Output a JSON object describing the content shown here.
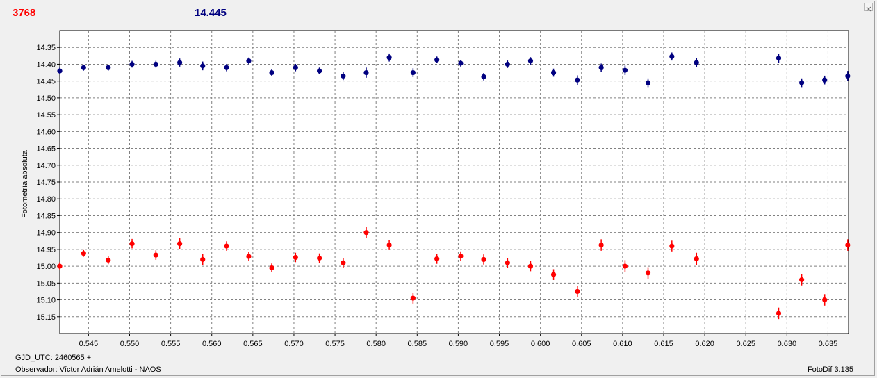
{
  "header": {
    "left_value": "3768",
    "right_value": "14.445"
  },
  "footer": {
    "gjd": "GJD_UTC: 2460565 +",
    "observer": "Observador: Víctor Adrián Amelotti - NAOS",
    "version": "FotoDif 3.135"
  },
  "colors": {
    "series_red": "#ff0000",
    "series_blue": "#000080"
  },
  "icons": {
    "close": "close-icon"
  },
  "chart_data": {
    "type": "scatter",
    "ylabel": "Fotometría absoluta",
    "xlabel": "",
    "xlim": [
      0.5415,
      0.6375
    ],
    "ylim": [
      14.3,
      15.2
    ],
    "y_inverted": true,
    "grid": true,
    "x_ticks": [
      "0.545",
      "0.550",
      "0.555",
      "0.560",
      "0.565",
      "0.570",
      "0.575",
      "0.580",
      "0.585",
      "0.590",
      "0.595",
      "0.600",
      "0.605",
      "0.610",
      "0.615",
      "0.620",
      "0.625",
      "0.630",
      "0.635"
    ],
    "y_ticks": [
      "14.35",
      "14.40",
      "14.45",
      "14.50",
      "14.55",
      "14.60",
      "14.65",
      "14.70",
      "14.75",
      "14.80",
      "14.85",
      "14.90",
      "14.95",
      "15.00",
      "15.05",
      "15.10",
      "15.15"
    ],
    "series": [
      {
        "color": "#000080",
        "x": [
          0.5415,
          0.5444,
          0.5474,
          0.5503,
          0.5532,
          0.5561,
          0.5589,
          0.5618,
          0.5645,
          0.5673,
          0.5702,
          0.5731,
          0.576,
          0.5788,
          0.5816,
          0.5845,
          0.5874,
          0.5903,
          0.5931,
          0.596,
          0.5988,
          0.6016,
          0.6045,
          0.6074,
          0.6103,
          0.6131,
          0.616,
          0.619,
          0.629,
          0.6318,
          0.6346,
          0.6374
        ],
        "y": [
          14.42,
          14.41,
          14.41,
          14.4,
          14.4,
          14.395,
          14.405,
          14.41,
          14.39,
          14.425,
          14.41,
          14.42,
          14.435,
          14.425,
          14.38,
          14.425,
          14.387,
          14.397,
          14.437,
          14.4,
          14.39,
          14.425,
          14.447,
          14.41,
          14.418,
          14.455,
          14.377,
          14.395,
          14.382,
          14.455,
          14.447,
          14.435
        ],
        "err": [
          0.01,
          0.009,
          0.009,
          0.01,
          0.01,
          0.012,
          0.013,
          0.011,
          0.01,
          0.01,
          0.011,
          0.01,
          0.012,
          0.015,
          0.012,
          0.013,
          0.01,
          0.01,
          0.011,
          0.011,
          0.011,
          0.012,
          0.014,
          0.012,
          0.014,
          0.013,
          0.012,
          0.013,
          0.013,
          0.013,
          0.013,
          0.015
        ]
      },
      {
        "color": "#ff0000",
        "x": [
          0.5415,
          0.5444,
          0.5474,
          0.5503,
          0.5532,
          0.5561,
          0.5589,
          0.5618,
          0.5645,
          0.5673,
          0.5702,
          0.5731,
          0.576,
          0.5788,
          0.5816,
          0.5845,
          0.5874,
          0.5903,
          0.5931,
          0.596,
          0.5988,
          0.6016,
          0.6045,
          0.6074,
          0.6103,
          0.6131,
          0.616,
          0.619,
          0.629,
          0.6318,
          0.6346,
          0.6374
        ],
        "y": [
          15.0,
          14.962,
          14.982,
          14.933,
          14.967,
          14.933,
          14.98,
          14.94,
          14.971,
          15.005,
          14.974,
          14.976,
          14.99,
          14.9,
          14.937,
          15.095,
          14.978,
          14.97,
          14.98,
          14.99,
          15.0,
          15.025,
          15.075,
          14.937,
          15.0,
          15.02,
          14.94,
          14.978,
          15.14,
          15.04,
          15.1,
          14.937
        ],
        "err": [
          0.012,
          0.01,
          0.012,
          0.014,
          0.014,
          0.016,
          0.017,
          0.014,
          0.013,
          0.013,
          0.014,
          0.014,
          0.015,
          0.017,
          0.015,
          0.016,
          0.015,
          0.014,
          0.015,
          0.014,
          0.015,
          0.016,
          0.017,
          0.017,
          0.018,
          0.017,
          0.016,
          0.018,
          0.017,
          0.017,
          0.017,
          0.017
        ]
      }
    ]
  }
}
